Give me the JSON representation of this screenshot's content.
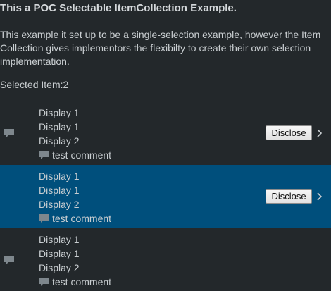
{
  "header": {
    "title": "This a POC Selectable ItemCollection Example.",
    "description": "This example it set up to be a single-selection example, however the Item Collection gives implementors the flexibilty to create their own selection implementation.",
    "selected_text": "Selected Item:2"
  },
  "items": [
    {
      "lines": [
        "Display 1",
        "Display 1",
        "Display 2"
      ],
      "comment": "test comment",
      "disclose_label": "Disclose",
      "selected": false,
      "icon": "comment-icon"
    },
    {
      "lines": [
        "Display 1",
        "Display 1",
        "Display 2"
      ],
      "comment": "test comment",
      "disclose_label": "Disclose",
      "selected": true,
      "icon": "comment-icon"
    },
    {
      "lines": [
        "Display 1",
        "Display 1",
        "Display 2"
      ],
      "comment": "test comment",
      "disclose_label": "",
      "selected": false,
      "icon": "comment-icon"
    }
  ],
  "colors": {
    "background": "#23282b",
    "selected_row": "#004f7c",
    "text": "#c9ced1",
    "icon": "#7e878d"
  }
}
